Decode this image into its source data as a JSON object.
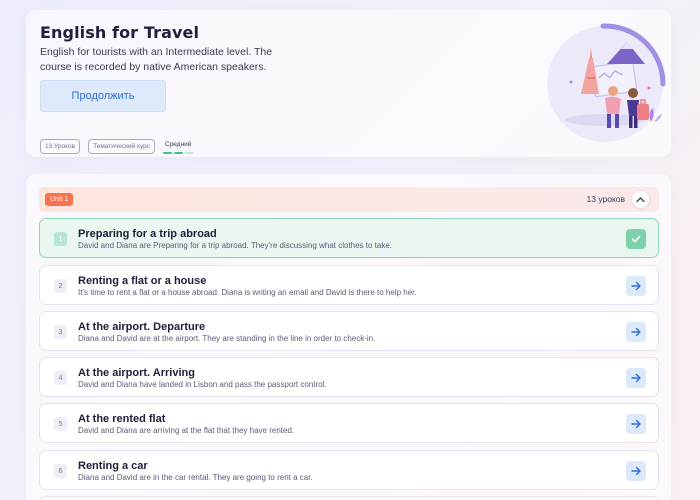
{
  "course": {
    "title": "English for Travel",
    "description": "English for tourists with an Intermediate level. The course is recorded by native American speakers.",
    "continue_label": "Продолжить",
    "chips": [
      "13 Уроков",
      "Тематический курс"
    ],
    "level_label": "Средний",
    "colors": {
      "level_active": "#3cc48a",
      "level_inactive": "#c9e6d8"
    }
  },
  "unit": {
    "badge": "Unit 1",
    "count_label": "13 уроков",
    "collapse_icon": "chevron-up-icon"
  },
  "lessons": [
    {
      "num": "1",
      "title": "Preparing for a trip abroad",
      "subtitle": "David and Diana are Preparing for a trip abroad. They're discussing what clothes to take.",
      "status": "done",
      "icon": "check-icon"
    },
    {
      "num": "2",
      "title": "Renting a flat or a house",
      "subtitle": "It's time to rent a flat or a house abroad. Diana is writing an email and David is there to help her.",
      "status": "open",
      "icon": "arrow-right-icon"
    },
    {
      "num": "3",
      "title": "At the airport. Departure",
      "subtitle": "Diana and David are at the airport. They are standing in the line in order to check-in.",
      "status": "open",
      "icon": "arrow-right-icon"
    },
    {
      "num": "4",
      "title": "At the airport. Arriving",
      "subtitle": "David and Diana have landed in Lisbon and pass the passport control.",
      "status": "open",
      "icon": "arrow-right-icon"
    },
    {
      "num": "5",
      "title": "At the rented flat",
      "subtitle": "David and Diana are arriving at the flat that they have rented.",
      "status": "open",
      "icon": "arrow-right-icon"
    },
    {
      "num": "6",
      "title": "Renting a car",
      "subtitle": "Diana and David are in the car rental. They are going to rent a car.",
      "status": "open",
      "icon": "arrow-right-icon"
    }
  ]
}
